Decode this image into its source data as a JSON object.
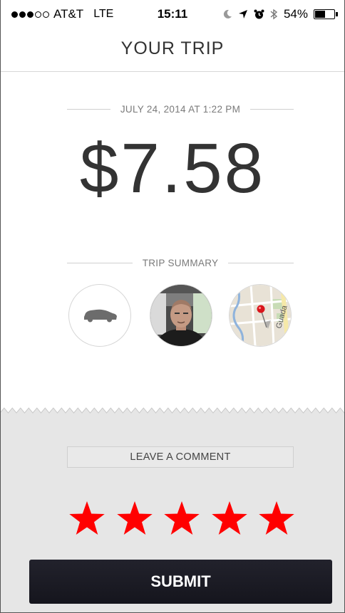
{
  "status_bar": {
    "carrier": "AT&T",
    "network": "LTE",
    "time": "15:11",
    "battery_text": "54%",
    "battery_level": 0.54,
    "signal_dots_filled": 3,
    "signal_dots_total": 5,
    "icons": [
      "moon-icon",
      "location-arrow-icon",
      "alarm-icon",
      "bluetooth-icon",
      "battery-icon"
    ]
  },
  "header": {
    "title": "YOUR TRIP"
  },
  "trip": {
    "datetime": "JULY 24, 2014 AT 1:22 PM",
    "fare": "$7.58"
  },
  "summary": {
    "label": "TRIP SUMMARY",
    "items": [
      {
        "name": "vehicle",
        "icon": "car-icon"
      },
      {
        "name": "driver-photo",
        "icon": "avatar"
      },
      {
        "name": "route-map",
        "icon": "map-pin-icon"
      }
    ]
  },
  "feedback": {
    "comment_label": "LEAVE A COMMENT",
    "rating": 5,
    "max_rating": 5,
    "star_color": "#ff0000"
  },
  "submit_label": "SUBMIT"
}
